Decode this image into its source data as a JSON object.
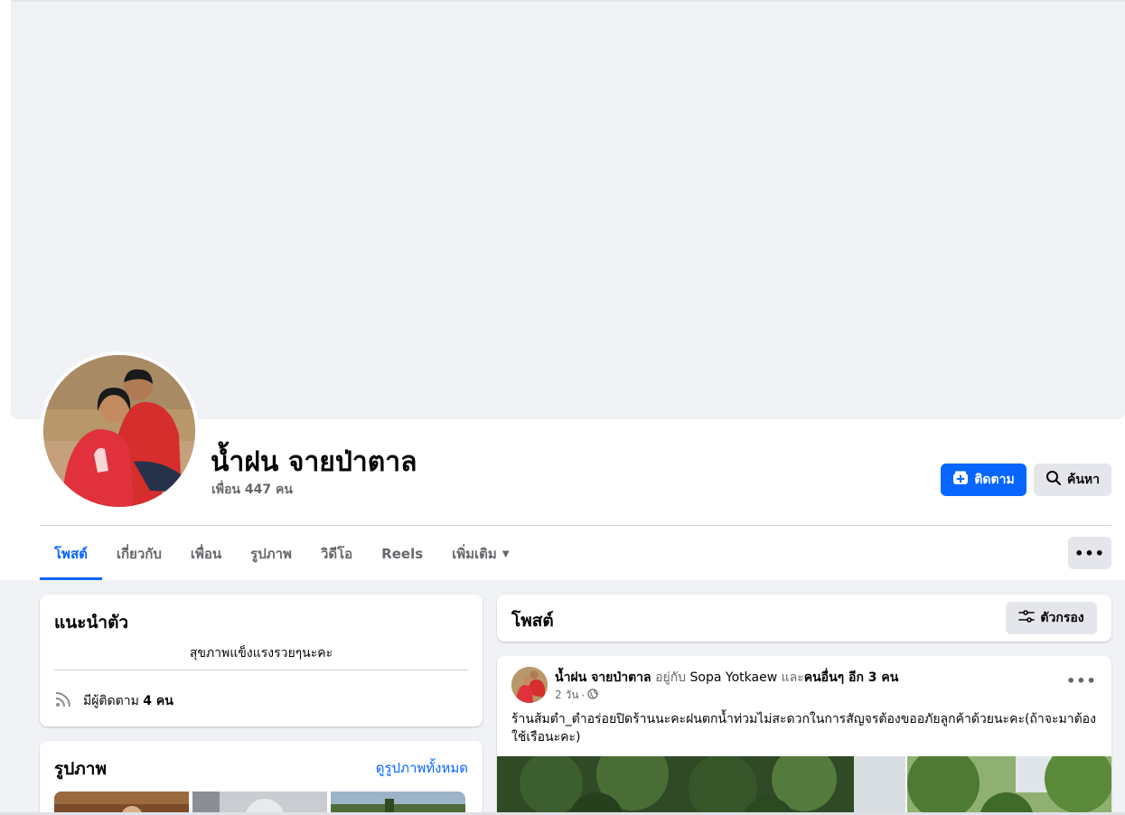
{
  "colors": {
    "accent": "#0866ff",
    "background": "#f0f2f5",
    "secondary_text": "#65676b",
    "button_grey": "#e4e6eb"
  },
  "profile": {
    "name": "น้ำฝน จายป่าตาล",
    "friends_count": "เพื่อน 447 คน",
    "follow_label": "ติดตาม",
    "follow_icon": "add-friend-icon",
    "search_label": "ค้นหา",
    "search_icon": "search-icon"
  },
  "tabs": [
    {
      "label": "โพสต์",
      "active": true
    },
    {
      "label": "เกี่ยวกับ",
      "active": false
    },
    {
      "label": "เพื่อน",
      "active": false
    },
    {
      "label": "รูปภาพ",
      "active": false
    },
    {
      "label": "วิดีโอ",
      "active": false
    },
    {
      "label": "Reels",
      "active": false
    },
    {
      "label": "เพิ่มเติม",
      "active": false
    }
  ],
  "more_menu": "•••",
  "intro": {
    "title": "แนะนำตัว",
    "bio": "สุขภาพแข็งแรงรวยๆนะคะ",
    "followers_prefix": "มีผู้ติดตาม",
    "followers_count": "4 คน",
    "followers_icon": "rss-feed-icon"
  },
  "photos": {
    "title": "รูปภาพ",
    "see_all": "ดูรูปภาพทั้งหมด"
  },
  "posts_section": {
    "title": "โพสต์",
    "filter_label": "ตัวกรอง",
    "filter_icon": "sliders-icon"
  },
  "post": {
    "author": "น้ำฝน จายป่าตาล",
    "with_text": "อยู่กับ",
    "tagged": "Sopa Yotkaew",
    "and_text": "และ",
    "others": "คนอื่นๆ อีก 3 คน",
    "time": "2 วัน",
    "separator": "·",
    "privacy_icon": "globe-icon",
    "options": "•••",
    "text": "ร้านส้มตำ_ตำอร่อยปิดร้านนะคะฝนตกน้ำท่วมไม่สะดวกในการสัญจรต้องขออภัยลูกค้าด้วยนะคะ(ถ้าจะมาต้องใช้เรือนะคะ)"
  }
}
